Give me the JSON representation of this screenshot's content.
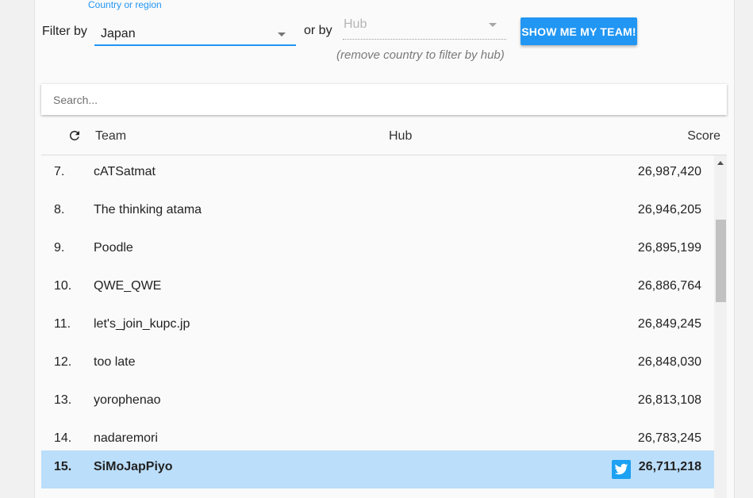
{
  "filter": {
    "label": "Filter by",
    "country_float_label": "Country or region",
    "country_value": "Japan",
    "or_by": "or by",
    "hub_placeholder": "Hub",
    "hub_hint": "(remove country to filter by hub)",
    "show_team_button": "SHOW ME MY TEAM!"
  },
  "search": {
    "placeholder": "Search..."
  },
  "table": {
    "headers": {
      "team": "Team",
      "hub": "Hub",
      "score": "Score"
    },
    "rows": [
      {
        "rank": "7.",
        "team": "cATSatmat",
        "hub": "",
        "score": "26,987,420"
      },
      {
        "rank": "8.",
        "team": "The thinking atama",
        "hub": "",
        "score": "26,946,205"
      },
      {
        "rank": "9.",
        "team": "Poodle",
        "hub": "",
        "score": "26,895,199"
      },
      {
        "rank": "10.",
        "team": "QWE_QWE",
        "hub": "",
        "score": "26,886,764"
      },
      {
        "rank": "11.",
        "team": "let's_join_kupc.jp",
        "hub": "",
        "score": "26,849,245"
      },
      {
        "rank": "12.",
        "team": "too late",
        "hub": "",
        "score": "26,848,030"
      },
      {
        "rank": "13.",
        "team": "yorophenao",
        "hub": "",
        "score": "26,813,108"
      },
      {
        "rank": "14.",
        "team": "nadaremori",
        "hub": "",
        "score": "26,783,245"
      },
      {
        "rank": "15.",
        "team": "SiMoJapPiyo",
        "hub": "",
        "score": "26,711,218"
      }
    ]
  },
  "icons": {
    "refresh": "refresh-icon",
    "twitter": "twitter-icon",
    "dropdown": "caret-down-icon"
  },
  "colors": {
    "accent": "#2196f3",
    "highlight_row": "#bbdefb",
    "twitter": "#1da1f2"
  }
}
